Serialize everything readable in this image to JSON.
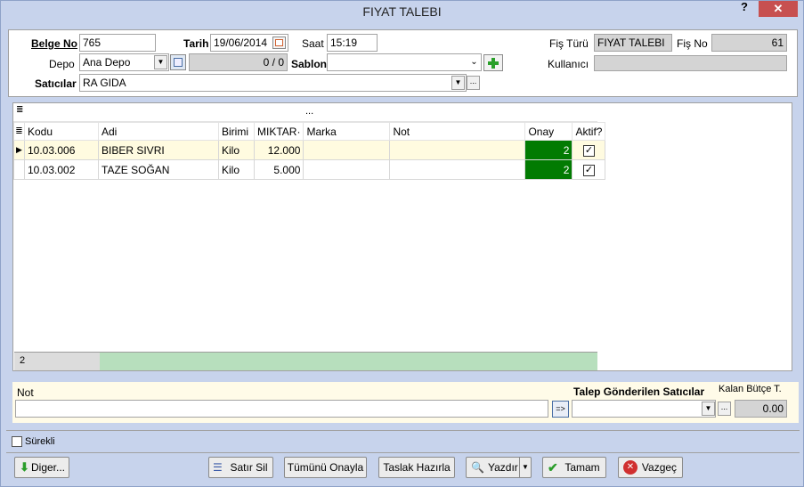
{
  "window": {
    "title": "FIYAT TALEBI",
    "help": "?",
    "close": "✕"
  },
  "header": {
    "belge_no_label": "Belge No",
    "belge_no": "765",
    "tarih_label": "Tarih",
    "tarih": "19/06/2014",
    "saat_label": "Saat",
    "saat": "15:19",
    "fis_turu_label": "Fiş Türü",
    "fis_turu": "FIYAT TALEBI",
    "fis_no_label": "Fiş No",
    "fis_no": "61",
    "depo_label": "Depo",
    "depo": "Ana Depo",
    "depo_count": "0 / 0",
    "sablon_label": "Sablon",
    "sablon": "",
    "kullanici_label": "Kullanıcı",
    "kullanici": "",
    "saticilar_label": "Satıcılar",
    "saticilar": "RA GIDA",
    "dots": "..."
  },
  "grid": {
    "group_text": "...",
    "columns": [
      "Kodu",
      "Adi",
      "Birimi",
      "MIKTAR·",
      "Marka",
      "Not",
      "Onay",
      "Aktif?"
    ],
    "rows": [
      {
        "kodu": "10.03.006",
        "adi": "BIBER SIVRI",
        "birimi": "Kilo",
        "miktar": "12.000",
        "marka": "",
        "not": "",
        "onay": "2",
        "aktif": "✓"
      },
      {
        "kodu": "10.03.002",
        "adi": "TAZE SOĞAN",
        "birimi": "Kilo",
        "miktar": "5.000",
        "marka": "",
        "not": "",
        "onay": "2",
        "aktif": "✓"
      }
    ],
    "footer_count": "2"
  },
  "note": {
    "not_label": "Not",
    "not_value": "",
    "arrow_btn": "=>",
    "talep_label": "Talep Gönderilen Satıcılar",
    "talep_value": "",
    "kalan_label": "Kalan Bütçe T.",
    "kalan_value": "0.00"
  },
  "surekli_label": "Sürekli",
  "buttons": {
    "diger": "Diger...",
    "satir_sil": "Satır Sil",
    "tumunu_onayla": "Tümünü Onayla",
    "taslak": "Taslak Hazırla",
    "yazdir": "Yazdır",
    "tamam": "Tamam",
    "vazgec": "Vazgeç"
  },
  "colors": {
    "onay_green": "#027b02",
    "title_bg": "#c7d3ec",
    "close_red": "#c75050"
  }
}
